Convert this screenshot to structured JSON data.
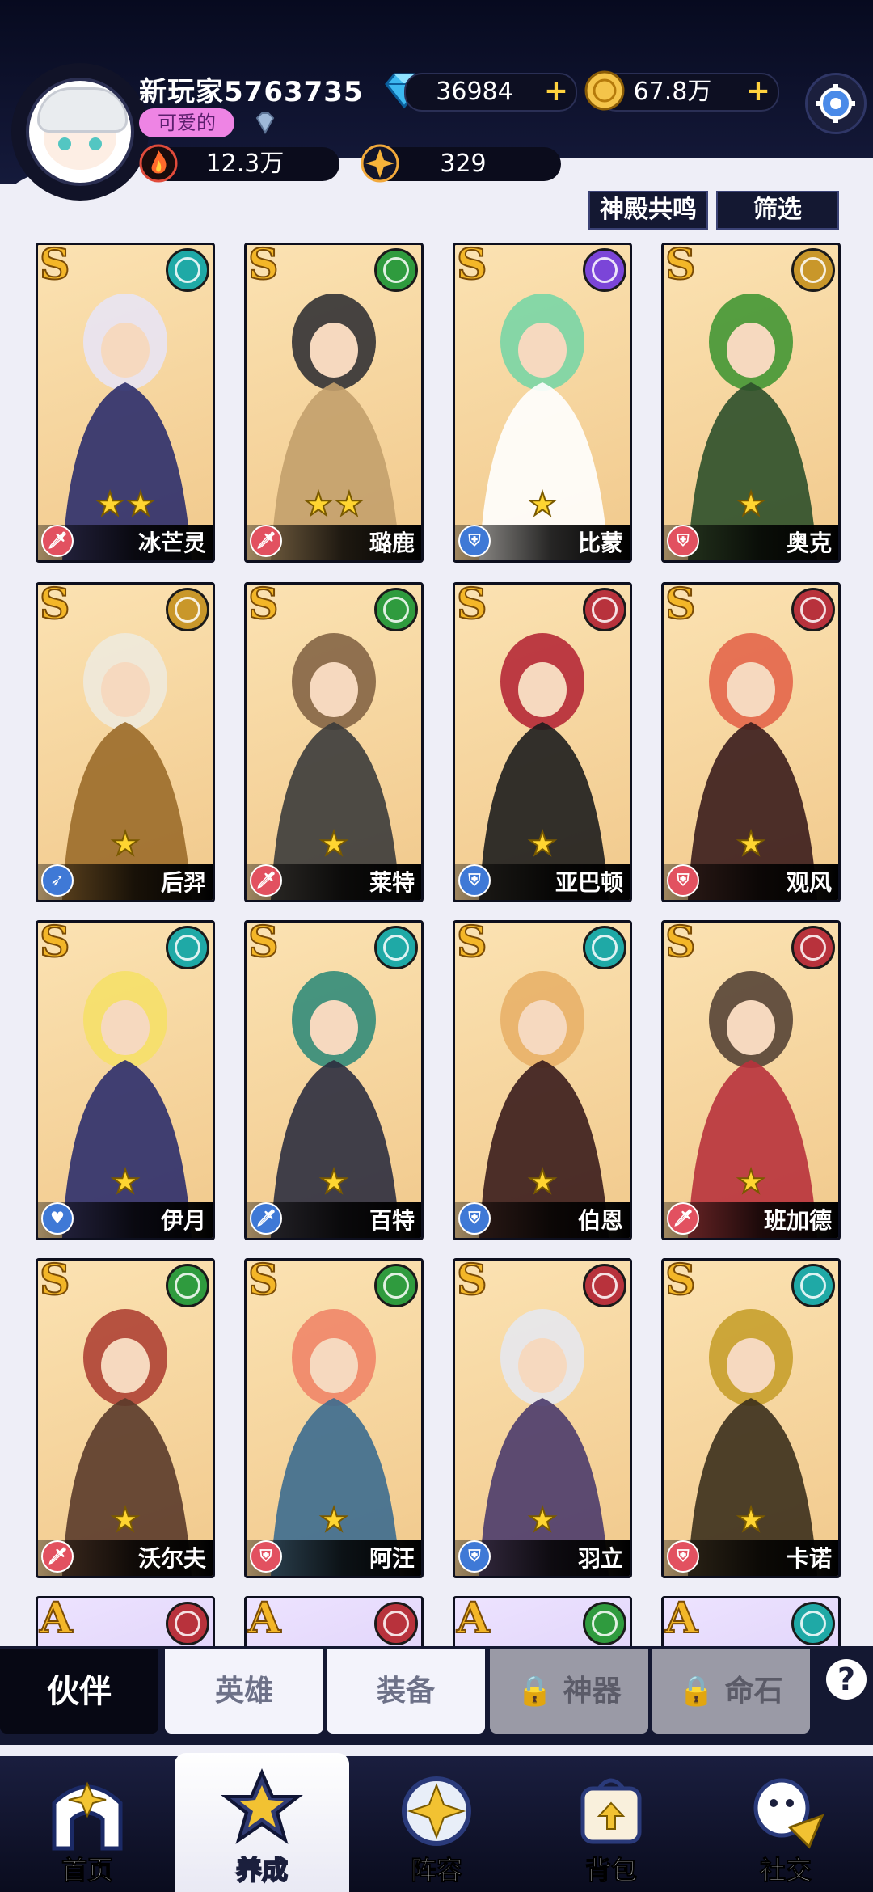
{
  "player": {
    "name": "新玩家5763735",
    "title_badge": "可爱的",
    "diamonds": "36984",
    "gold": "67.8万",
    "power": "12.3万",
    "stars_count": "329"
  },
  "buttons": {
    "resonance": "神殿共鸣",
    "filter": "筛选"
  },
  "cards": [
    {
      "grade": "S",
      "name": "冰芒灵",
      "stars": 2,
      "faction_color": "#1fa9a6",
      "role_color": "#e25160",
      "role": "🗡"
    },
    {
      "grade": "S",
      "name": "璐鹿",
      "stars": 2,
      "faction_color": "#2f9b3e",
      "role_color": "#e25160",
      "role": "🗡"
    },
    {
      "grade": "S",
      "name": "比蒙",
      "stars": 1,
      "faction_color": "#7b45d8",
      "role_color": "#3f79d6",
      "role": "⛨"
    },
    {
      "grade": "S",
      "name": "奥克",
      "stars": 1,
      "faction_color": "#c9972a",
      "role_color": "#e25160",
      "role": "⛨"
    },
    {
      "grade": "S",
      "name": "后羿",
      "stars": 1,
      "faction_color": "#c9972a",
      "role_color": "#3f79d6",
      "role": "➶"
    },
    {
      "grade": "S",
      "name": "莱特",
      "stars": 1,
      "faction_color": "#2f9b3e",
      "role_color": "#e25160",
      "role": "🗡"
    },
    {
      "grade": "S",
      "name": "亚巴顿",
      "stars": 1,
      "faction_color": "#b8323c",
      "role_color": "#3f79d6",
      "role": "⛨"
    },
    {
      "grade": "S",
      "name": "观风",
      "stars": 1,
      "faction_color": "#b8323c",
      "role_color": "#e25160",
      "role": "⛨"
    },
    {
      "grade": "S",
      "name": "伊月",
      "stars": 1,
      "faction_color": "#1fa9a6",
      "role_color": "#3f79d6",
      "role": "♥"
    },
    {
      "grade": "S",
      "name": "百特",
      "stars": 1,
      "faction_color": "#1fa9a6",
      "role_color": "#3f79d6",
      "role": "🗡"
    },
    {
      "grade": "S",
      "name": "伯恩",
      "stars": 1,
      "faction_color": "#1fa9a6",
      "role_color": "#3f79d6",
      "role": "⛨"
    },
    {
      "grade": "S",
      "name": "班加德",
      "stars": 1,
      "faction_color": "#b8323c",
      "role_color": "#e25160",
      "role": "🗡"
    },
    {
      "grade": "S",
      "name": "沃尔夫",
      "stars": 1,
      "faction_color": "#2f9b3e",
      "role_color": "#e25160",
      "role": "🗡"
    },
    {
      "grade": "S",
      "name": "阿汪",
      "stars": 1,
      "faction_color": "#2f9b3e",
      "role_color": "#e25160",
      "role": "⛨"
    },
    {
      "grade": "S",
      "name": "羽立",
      "stars": 1,
      "faction_color": "#b8323c",
      "role_color": "#3f79d6",
      "role": "⛨"
    },
    {
      "grade": "S",
      "name": "卡诺",
      "stars": 1,
      "faction_color": "#1fa9a6",
      "role_color": "#e25160",
      "role": "⛨"
    },
    {
      "grade": "A",
      "name": "",
      "stars": 0,
      "faction_color": "#b8323c",
      "role_color": "#e25160",
      "role": ""
    },
    {
      "grade": "A",
      "name": "",
      "stars": 0,
      "faction_color": "#b8323c",
      "role_color": "#e25160",
      "role": ""
    },
    {
      "grade": "A",
      "name": "",
      "stars": 0,
      "faction_color": "#2f9b3e",
      "role_color": "#e25160",
      "role": ""
    },
    {
      "grade": "A",
      "name": "",
      "stars": 0,
      "faction_color": "#1fa9a6",
      "role_color": "#e25160",
      "role": ""
    }
  ],
  "tabs": [
    {
      "label": "伙伴",
      "state": "active"
    },
    {
      "label": "英雄",
      "state": "normal"
    },
    {
      "label": "装备",
      "state": "normal"
    },
    {
      "label": "神器",
      "state": "locked"
    },
    {
      "label": "命石",
      "state": "locked"
    }
  ],
  "help_label": "?",
  "nav": [
    {
      "label": "首页",
      "icon": "home-icon",
      "active": false
    },
    {
      "label": "养成",
      "icon": "cultivate-icon",
      "active": true
    },
    {
      "label": "阵容",
      "icon": "lineup-icon",
      "active": false
    },
    {
      "label": "背包",
      "icon": "backpack-icon",
      "active": false
    },
    {
      "label": "社交",
      "icon": "social-icon",
      "active": false
    }
  ]
}
